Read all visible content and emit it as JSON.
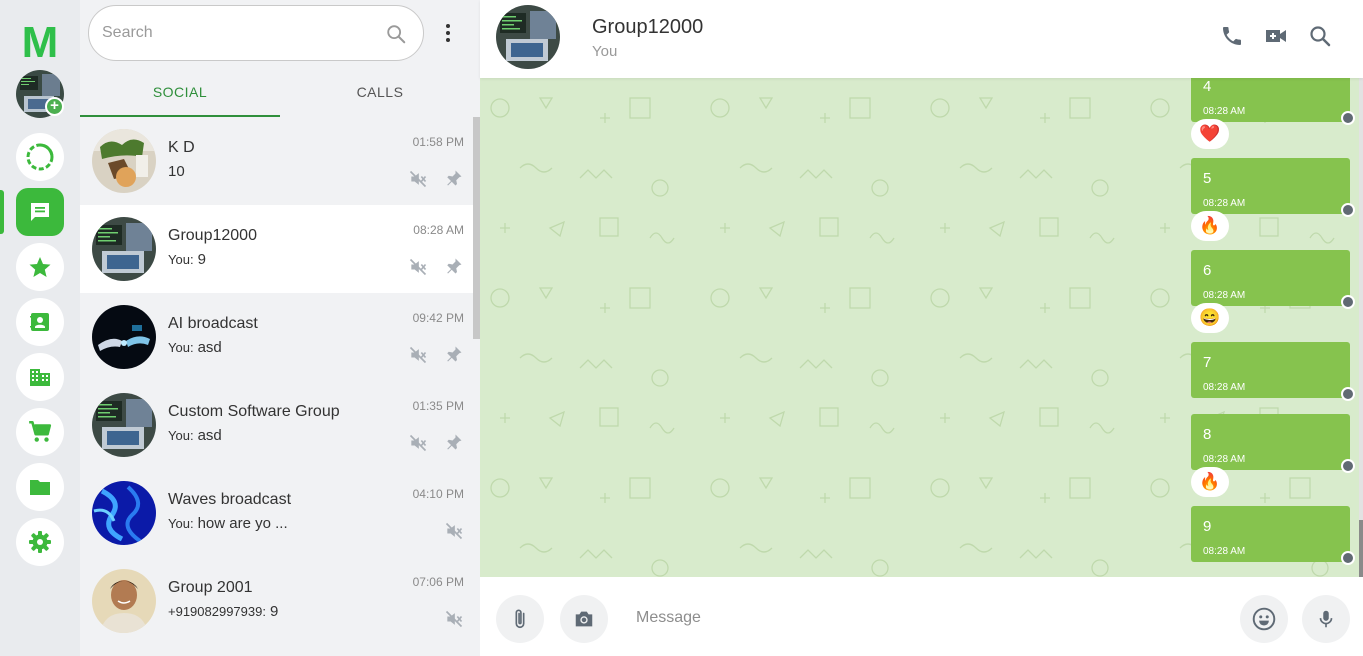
{
  "app": {
    "logo_letter": "M",
    "accent": "#3cb93c"
  },
  "rail": {
    "items": [
      {
        "name": "status",
        "icon": "status-ring-icon"
      },
      {
        "name": "chats",
        "icon": "chat-bubble-icon",
        "active": true
      },
      {
        "name": "starred",
        "icon": "star-icon"
      },
      {
        "name": "contacts",
        "icon": "contact-card-icon"
      },
      {
        "name": "business",
        "icon": "building-icon"
      },
      {
        "name": "shop",
        "icon": "cart-icon"
      },
      {
        "name": "files",
        "icon": "folder-icon"
      },
      {
        "name": "settings",
        "icon": "gear-icon"
      }
    ]
  },
  "search": {
    "placeholder": "Search"
  },
  "tabs": [
    {
      "label": "SOCIAL",
      "active": true
    },
    {
      "label": "CALLS",
      "active": false
    }
  ],
  "chats": [
    {
      "name": "K D",
      "time": "01:58 PM",
      "who": "",
      "preview": "10",
      "muted": true,
      "pinned": true
    },
    {
      "name": "Group12000",
      "time": "08:28 AM",
      "who": "You:",
      "preview": "9",
      "muted": true,
      "pinned": true,
      "selected": true
    },
    {
      "name": "AI broadcast",
      "time": "09:42 PM",
      "who": "You:",
      "preview": "asd",
      "muted": true,
      "pinned": true
    },
    {
      "name": "Custom Software Group",
      "time": "01:35 PM",
      "who": "You:",
      "preview": "asd",
      "muted": true,
      "pinned": true
    },
    {
      "name": "Waves broadcast",
      "time": "04:10 PM",
      "who": "You:",
      "preview": "how are yo ...",
      "muted": true,
      "pinned": false
    },
    {
      "name": "Group 2001",
      "time": "07:06 PM",
      "who": "+919082997939:",
      "preview": "9",
      "muted": true,
      "pinned": false
    }
  ],
  "conversation": {
    "title": "Group12000",
    "subtitle": "You",
    "messages": [
      {
        "text": "4",
        "time": "08:28 AM",
        "reaction": "❤️"
      },
      {
        "text": "5",
        "time": "08:28 AM",
        "reaction": "🔥"
      },
      {
        "text": "6",
        "time": "08:28 AM",
        "reaction": "😄"
      },
      {
        "text": "7",
        "time": "08:28 AM",
        "reaction": ""
      },
      {
        "text": "8",
        "time": "08:28 AM",
        "reaction": "🔥"
      },
      {
        "text": "9",
        "time": "08:28 AM",
        "reaction": ""
      }
    ]
  },
  "composer": {
    "placeholder": "Message"
  }
}
